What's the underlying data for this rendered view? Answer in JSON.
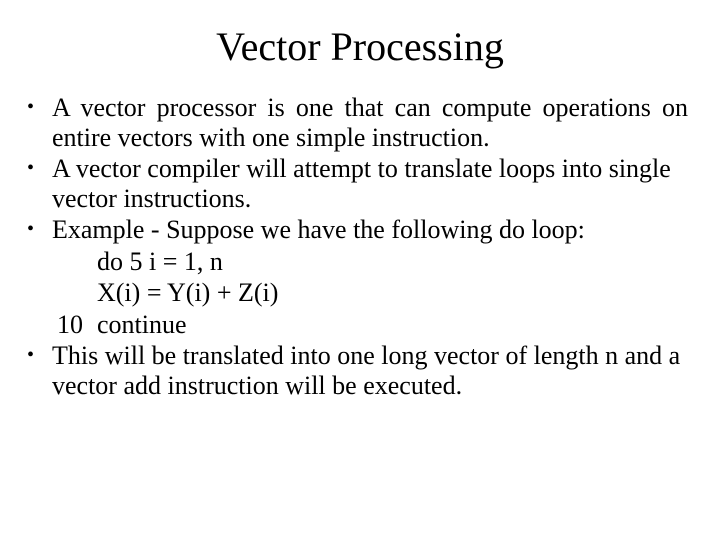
{
  "slide": {
    "title": "Vector Processing",
    "bullet_glyph": "•",
    "bullets": [
      {
        "text": "A vector processor is one that can compute operations on entire vectors with one simple instruction."
      },
      {
        "text": "A vector compiler will attempt to translate loops into single vector instructions."
      },
      {
        "text": "Example - Suppose we have the following do loop:"
      },
      {
        "text": "This will be translated into one long vector of length n and a vector add instruction will be executed."
      }
    ],
    "code": {
      "line1": "do 5 i = 1, n",
      "line2": "X(i) = Y(i) + Z(i)",
      "line3_label": "10",
      "line3_text": "continue"
    }
  }
}
